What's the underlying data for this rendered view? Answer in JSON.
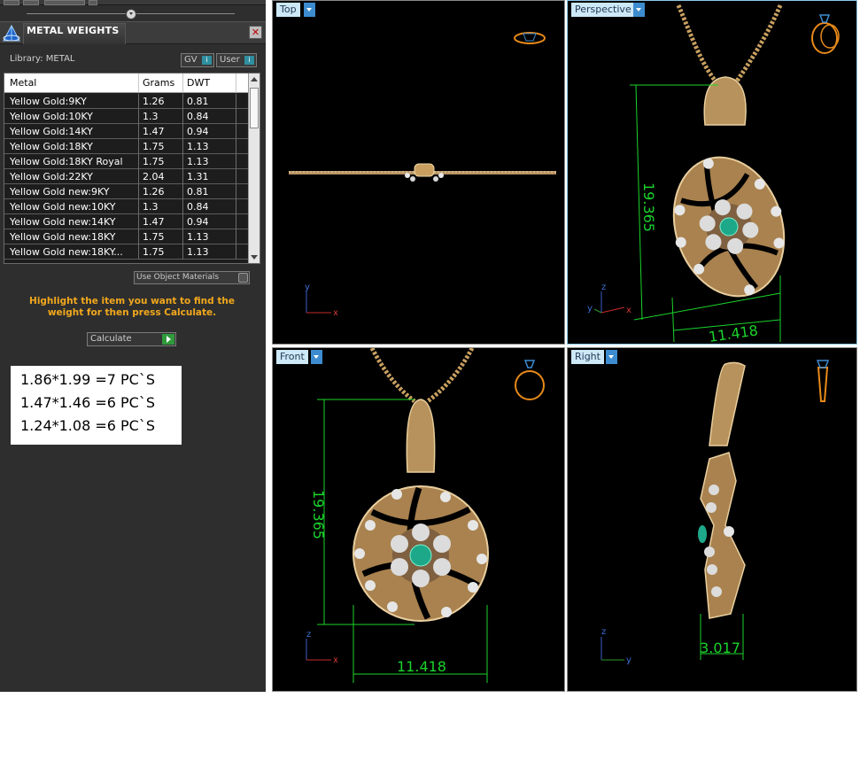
{
  "panel": {
    "title": "METAL WEIGHTS",
    "library_label": "Library: METAL",
    "gv_label": "GV",
    "user_label": "User",
    "columns": [
      "Metal",
      "Grams",
      "DWT"
    ],
    "rows": [
      {
        "metal": "Yellow Gold:9KY",
        "grams": "1.26",
        "dwt": "0.81"
      },
      {
        "metal": "Yellow Gold:10KY",
        "grams": "1.3",
        "dwt": "0.84"
      },
      {
        "metal": "Yellow Gold:14KY",
        "grams": "1.47",
        "dwt": "0.94"
      },
      {
        "metal": "Yellow Gold:18KY",
        "grams": "1.75",
        "dwt": "1.13"
      },
      {
        "metal": "Yellow Gold:18KY Royal",
        "grams": "1.75",
        "dwt": "1.13"
      },
      {
        "metal": "Yellow Gold:22KY",
        "grams": "2.04",
        "dwt": "1.31"
      },
      {
        "metal": "Yellow Gold new:9KY",
        "grams": "1.26",
        "dwt": "0.81"
      },
      {
        "metal": "Yellow Gold new:10KY",
        "grams": "1.3",
        "dwt": "0.84"
      },
      {
        "metal": "Yellow Gold new:14KY",
        "grams": "1.47",
        "dwt": "0.94"
      },
      {
        "metal": "Yellow Gold new:18KY",
        "grams": "1.75",
        "dwt": "1.13"
      },
      {
        "metal": "Yellow Gold new:18KY...",
        "grams": "1.75",
        "dwt": "1.13"
      }
    ],
    "use_object_materials": "Use Object Materials",
    "hint": "Highlight the item you want to find the weight for then press Calculate.",
    "calculate_label": "Calculate"
  },
  "notes": [
    "1.86*1.99 =7 PC`S",
    "1.47*1.46 =6 PC`S",
    "1.24*1.08 =6 PC`S"
  ],
  "viewports": {
    "top": {
      "label": "Top"
    },
    "perspective": {
      "label": "Perspective",
      "dim_height": "19.365",
      "dim_width": "11.418"
    },
    "front": {
      "label": "Front",
      "dim_height": "19.365",
      "dim_width": "11.418"
    },
    "right": {
      "label": "Right",
      "dim_depth": "3.017"
    }
  },
  "axes": {
    "x": "x",
    "y": "y",
    "z": "z"
  },
  "colors": {
    "panel_bg": "#2e2e2e",
    "hint_text": "#f2a81d",
    "dimension_green": "#1bd42b",
    "gold": "#c9a060",
    "emerald": "#1ea88a",
    "viewport_label_bg": "#cde8f7",
    "viewport_active_border": "#8fc7ea"
  }
}
